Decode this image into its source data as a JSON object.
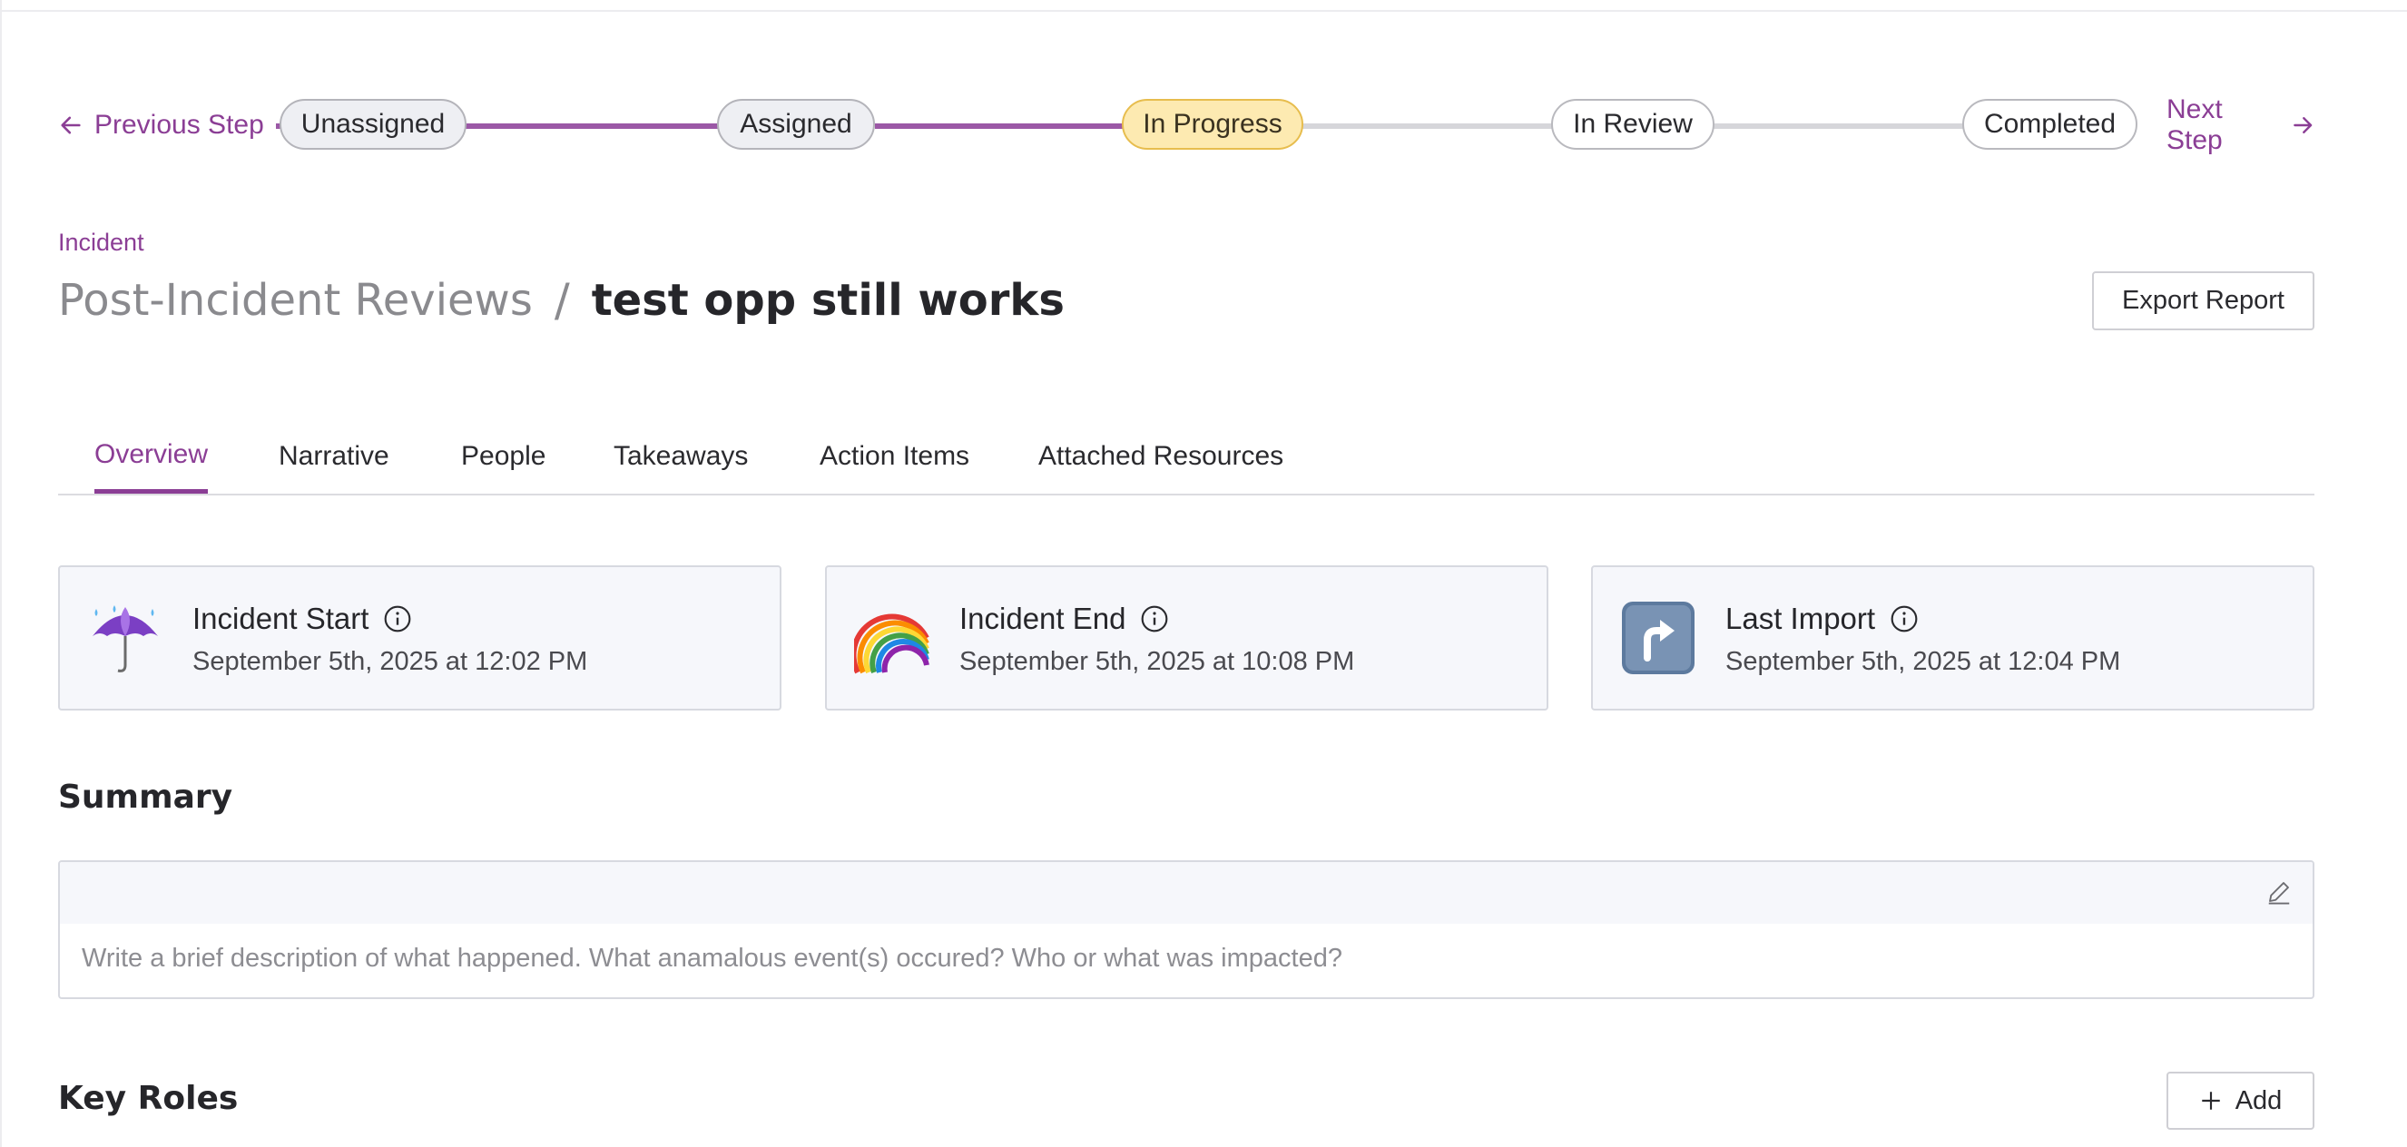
{
  "stepper": {
    "prev_label": "Previous Step",
    "next_label": "Next Step",
    "steps": [
      {
        "label": "Unassigned",
        "state": "done"
      },
      {
        "label": "Assigned",
        "state": "done"
      },
      {
        "label": "In Progress",
        "state": "current"
      },
      {
        "label": "In Review",
        "state": "pending"
      },
      {
        "label": "Completed",
        "state": "pending"
      }
    ]
  },
  "header": {
    "category": "Incident",
    "parent": "Post-Incident Reviews",
    "separator": "/",
    "title": "test opp still works",
    "export_label": "Export Report"
  },
  "tabs": [
    {
      "label": "Overview",
      "active": true
    },
    {
      "label": "Narrative",
      "active": false
    },
    {
      "label": "People",
      "active": false
    },
    {
      "label": "Takeaways",
      "active": false
    },
    {
      "label": "Action Items",
      "active": false
    },
    {
      "label": "Attached Resources",
      "active": false
    }
  ],
  "cards": [
    {
      "label": "Incident Start",
      "value": "September 5th, 2025 at 12:02 PM",
      "icon": "umbrella-rain-emoji"
    },
    {
      "label": "Incident End",
      "value": "September 5th, 2025 at 10:08 PM",
      "icon": "rainbow-emoji"
    },
    {
      "label": "Last Import",
      "value": "September 5th, 2025 at 12:04 PM",
      "icon": "arrow-up-right-emoji"
    }
  ],
  "summary": {
    "title": "Summary",
    "placeholder": "Write a brief description of what happened. What anamalous event(s) occured? Who or what was impacted?"
  },
  "key_roles": {
    "title": "Key Roles",
    "add_label": "Add"
  },
  "colors": {
    "accent": "#8b3e95",
    "current_step": "#fdeab1",
    "card_bg": "#f6f7fb"
  }
}
